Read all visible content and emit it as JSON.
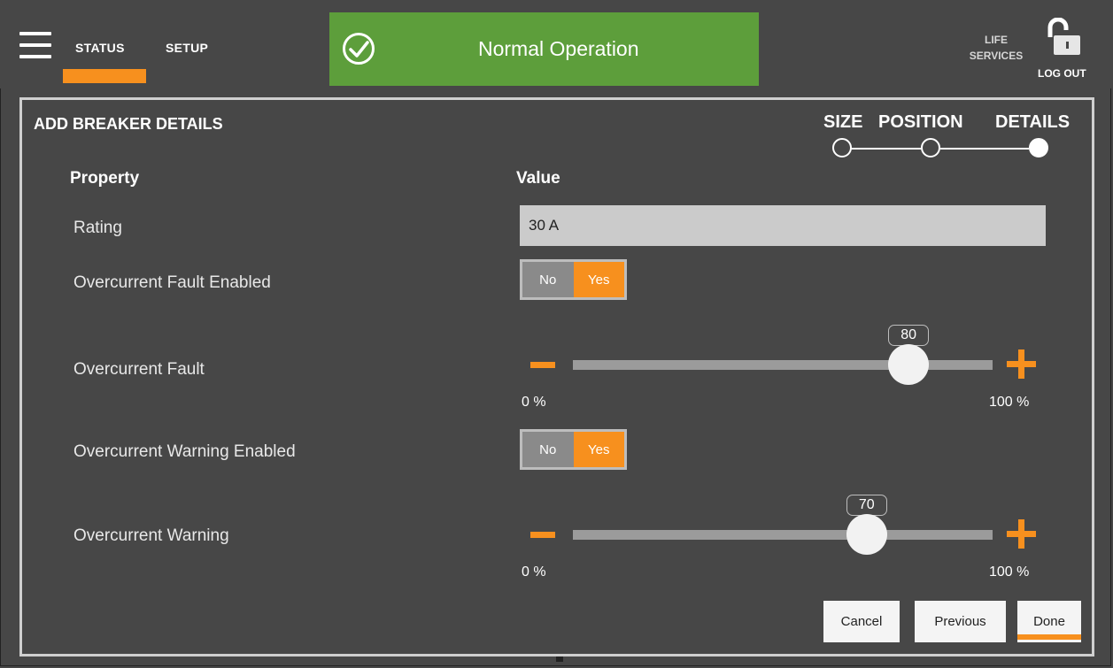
{
  "header": {
    "tabs": [
      {
        "label": "STATUS",
        "active": true
      },
      {
        "label": "SETUP",
        "active": false
      }
    ],
    "status_banner": {
      "text": "Normal Operation",
      "icon": "check-circle-icon",
      "color": "#5d9e3b"
    },
    "life_services": "LIFE SERVICES",
    "logout": "LOG OUT"
  },
  "panel": {
    "title": "ADD BREAKER DETAILS",
    "steps": [
      {
        "label": "SIZE",
        "state": "done"
      },
      {
        "label": "POSITION",
        "state": "done"
      },
      {
        "label": "DETAILS",
        "state": "current"
      }
    ],
    "columns": {
      "property": "Property",
      "value": "Value"
    },
    "rows": {
      "rating": {
        "label": "Rating",
        "value": "30 A"
      },
      "fault_enabled": {
        "label": "Overcurrent Fault Enabled",
        "no": "No",
        "yes": "Yes",
        "selected": "Yes"
      },
      "fault": {
        "label": "Overcurrent Fault",
        "value": "80",
        "min_label": "0 %",
        "max_label": "100 %",
        "min": 0,
        "max": 100
      },
      "warning_enabled": {
        "label": "Overcurrent Warning Enabled",
        "no": "No",
        "yes": "Yes",
        "selected": "Yes"
      },
      "warning": {
        "label": "Overcurrent Warning",
        "value": "70",
        "min_label": "0 %",
        "max_label": "100 %",
        "min": 0,
        "max": 100
      }
    },
    "buttons": {
      "cancel": "Cancel",
      "previous": "Previous",
      "done": "Done"
    }
  },
  "colors": {
    "accent": "#f7901e",
    "background": "#474747",
    "banner": "#5d9e3b"
  }
}
